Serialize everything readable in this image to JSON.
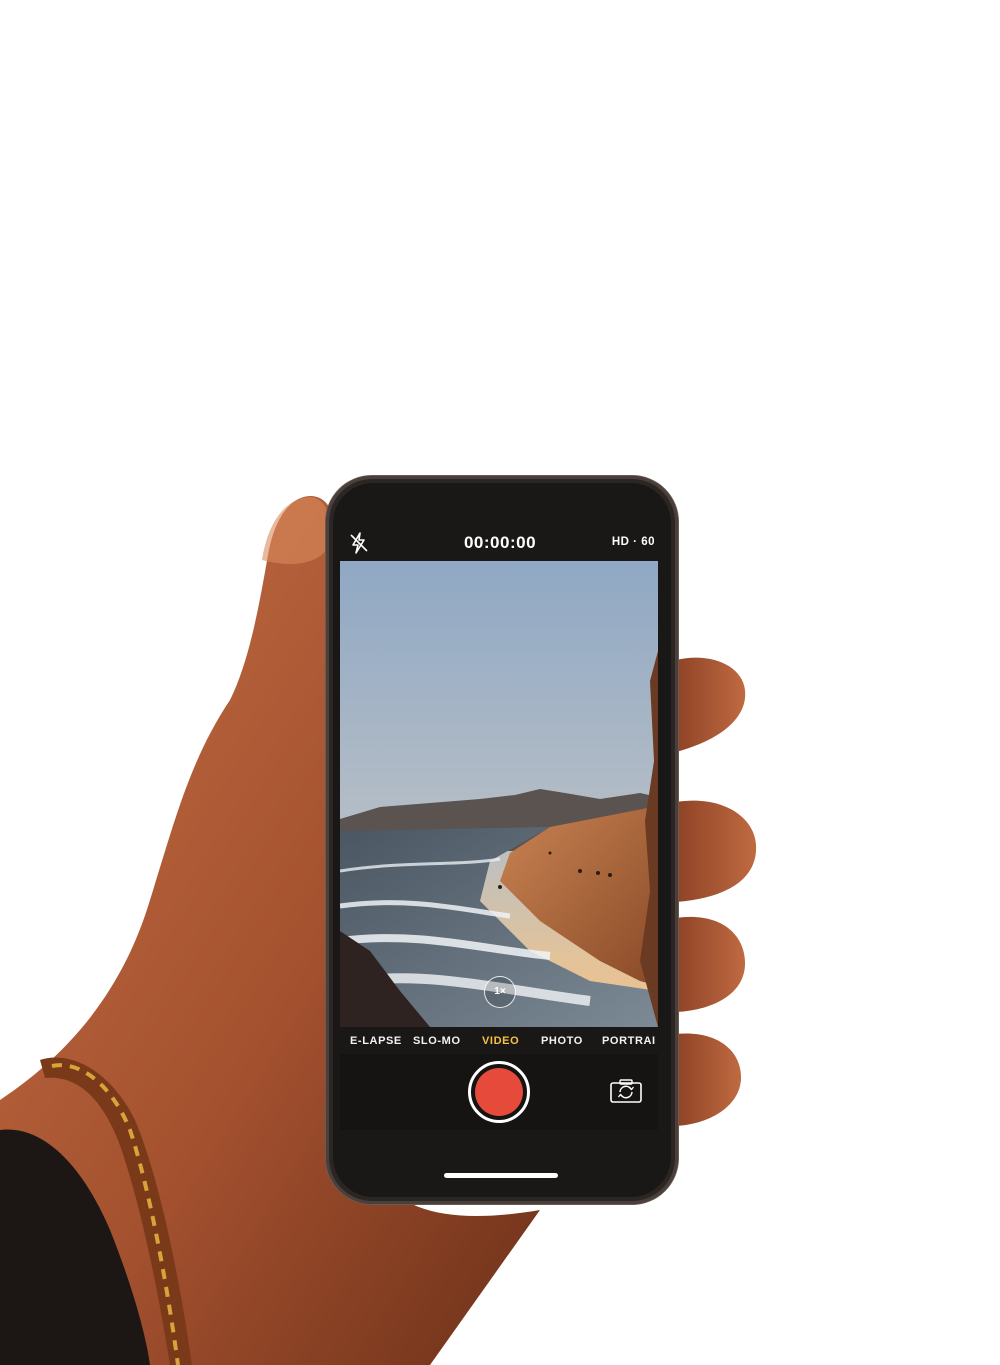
{
  "camera": {
    "flash_icon": "flash-off-icon",
    "timer": "00:00:00",
    "format": "HD · 60",
    "zoom": "1×",
    "modes": [
      "E-LAPSE",
      "SLO-MO",
      "VIDEO",
      "PHOTO",
      "PORTRAI"
    ],
    "active_mode": "VIDEO",
    "shutter_color": "#e54a3a",
    "active_mode_color": "#f5c242",
    "flip_icon": "camera-flip-icon"
  }
}
